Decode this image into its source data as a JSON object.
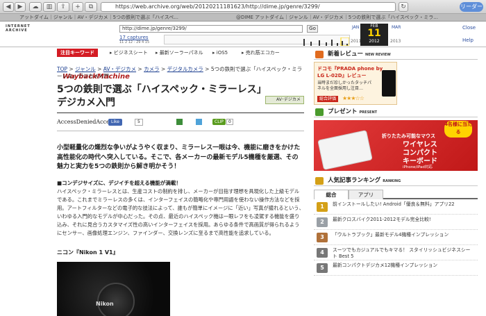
{
  "browser": {
    "url": "https://web.archive.org/web/20120211181623/http://dime.jp/genre/3299/",
    "tab_title": "アットダイム｜ジャンル｜AV・デジカメ｜5つの鉄則で選ぶ「ハイスペ...",
    "tab_title_2": "@DIME アットダイム｜ジャンル｜AV・デジカメ｜5つの鉄則で選ぶ「ハイスペック・ミラ...",
    "reader_label": "リーダー"
  },
  "wayback": {
    "logo_top": "INTERNET ARCHIVE",
    "logo_main": "WaybackMachine",
    "url_value": "http://dime.jp/genre/3299/",
    "go_label": "Go",
    "captures_label": "17 captures",
    "capture_dates": "11 2 12 - 29 4 15",
    "month_prev": "JAN",
    "month_cur": "FEB",
    "month_next": "MAR",
    "day": "11",
    "year_prev": "2011",
    "year_cur": "2012",
    "year_next": "2013",
    "close_label": "Close",
    "help_label": "Help"
  },
  "keywords": {
    "label": "注目キーワード",
    "items": [
      "ビジネスシート",
      "最新ソーラーパネル",
      "iOS5",
      "売れ筋エコカー"
    ]
  },
  "breadcrumb": {
    "items": [
      "TOP",
      "ジャンル",
      "AV・デジカメ",
      "カメラ",
      "デジタルカメラ"
    ],
    "current": "5つの鉄則で選ぶ「ハイスペック・ミラーレス」デジカメ入門"
  },
  "article": {
    "title": "5つの鉄則で選ぶ「ハイスペック・ミラーレス」デジカメ入門",
    "category_badge": "AV･デジカメ",
    "byline": "AccessDeniedAcces",
    "like_label": "Like",
    "like_count": "5",
    "clip_label": "CLIP",
    "clip_count": "0",
    "lede": "小型軽量化の熾烈な争いがようやく収まり、ミラーレス一眼は今、機能に磨きをかけた高性能化の時代へ突入している。そこで、各メーカーの最新モデル5機種を厳選、その魅力と実力を5つの鉄則から解き明かそう！",
    "subhead": "■コンデジサイズに、デジイチを超える機能が満載！",
    "body": "ハイスペック・ミラーレスとは、生産コストの制約を排し、メーカーが目指す理想を具現化した上級モデルである。これまでミラーレスの多くは、インターフェイスの簡略化や専門用語を使わない操作方法などを採用。アートフィルターなどの電子的な技法によって、誰もが簡単にイメージに「近い」写真が撮れるという、いわゆる入門的なモデルが中心だった。その点、最近のハイスペック機は一眼レフをも凌駕する機能を盛り込み、それに見合うカスタマイズ性の高いインターフェイスを採用。あらゆる条件で高画質が得られるようにセンサー、画像処理エンジン、ファインダー、交換レンズに至るまで高性能を追求している。",
    "caption": "ニコン『Nikon 1 V1』",
    "camera_brand": "Nikon"
  },
  "sidebar": {
    "review_head": "新着レビュー",
    "review_head_en": "NEW REVIEW",
    "review_t1": "ドコモ『PRADA phone by",
    "review_t2": "LG L-02D』レビュー",
    "review_t3": "当時まだ珍しかったタッチパネルを全面採用し注目…",
    "review_eval": "総合評価",
    "review_stars": "★★★☆☆",
    "present_head": "プレゼント",
    "present_head_en": "PRESENT",
    "present_t1": "折りたたみ可能なマウス",
    "present_t2": "ワイヤレス",
    "present_t3": "コンパクト",
    "present_t4": "キーボード",
    "present_t5": "iPhone/iPad対応",
    "present_burst": "4名様に当たる",
    "ranking_head": "人気記事ランキング",
    "ranking_head_en": "RANKING",
    "tabs": [
      "総合",
      "アプリ"
    ],
    "ranking": [
      {
        "num": "1",
        "title": "前インストールしたい! Android「優良＆無料」アプリ22"
      },
      {
        "num": "2",
        "title": "最新クロスバイク2011-2012モデル完全比較!"
      },
      {
        "num": "3",
        "title": "「ウルトラブック」最新モデル4機種インプレッション"
      },
      {
        "num": "4",
        "title": "スーツでもカジュアルでもキマる！ スタイリッシュビジネスシート Best 5"
      },
      {
        "num": "5",
        "title": "最新コンパクトデジカメ12機種インプレッション"
      }
    ]
  },
  "colors": {
    "accent": "#d41c24",
    "link": "#1a3d8f",
    "rank_gold": "#d4a017"
  }
}
